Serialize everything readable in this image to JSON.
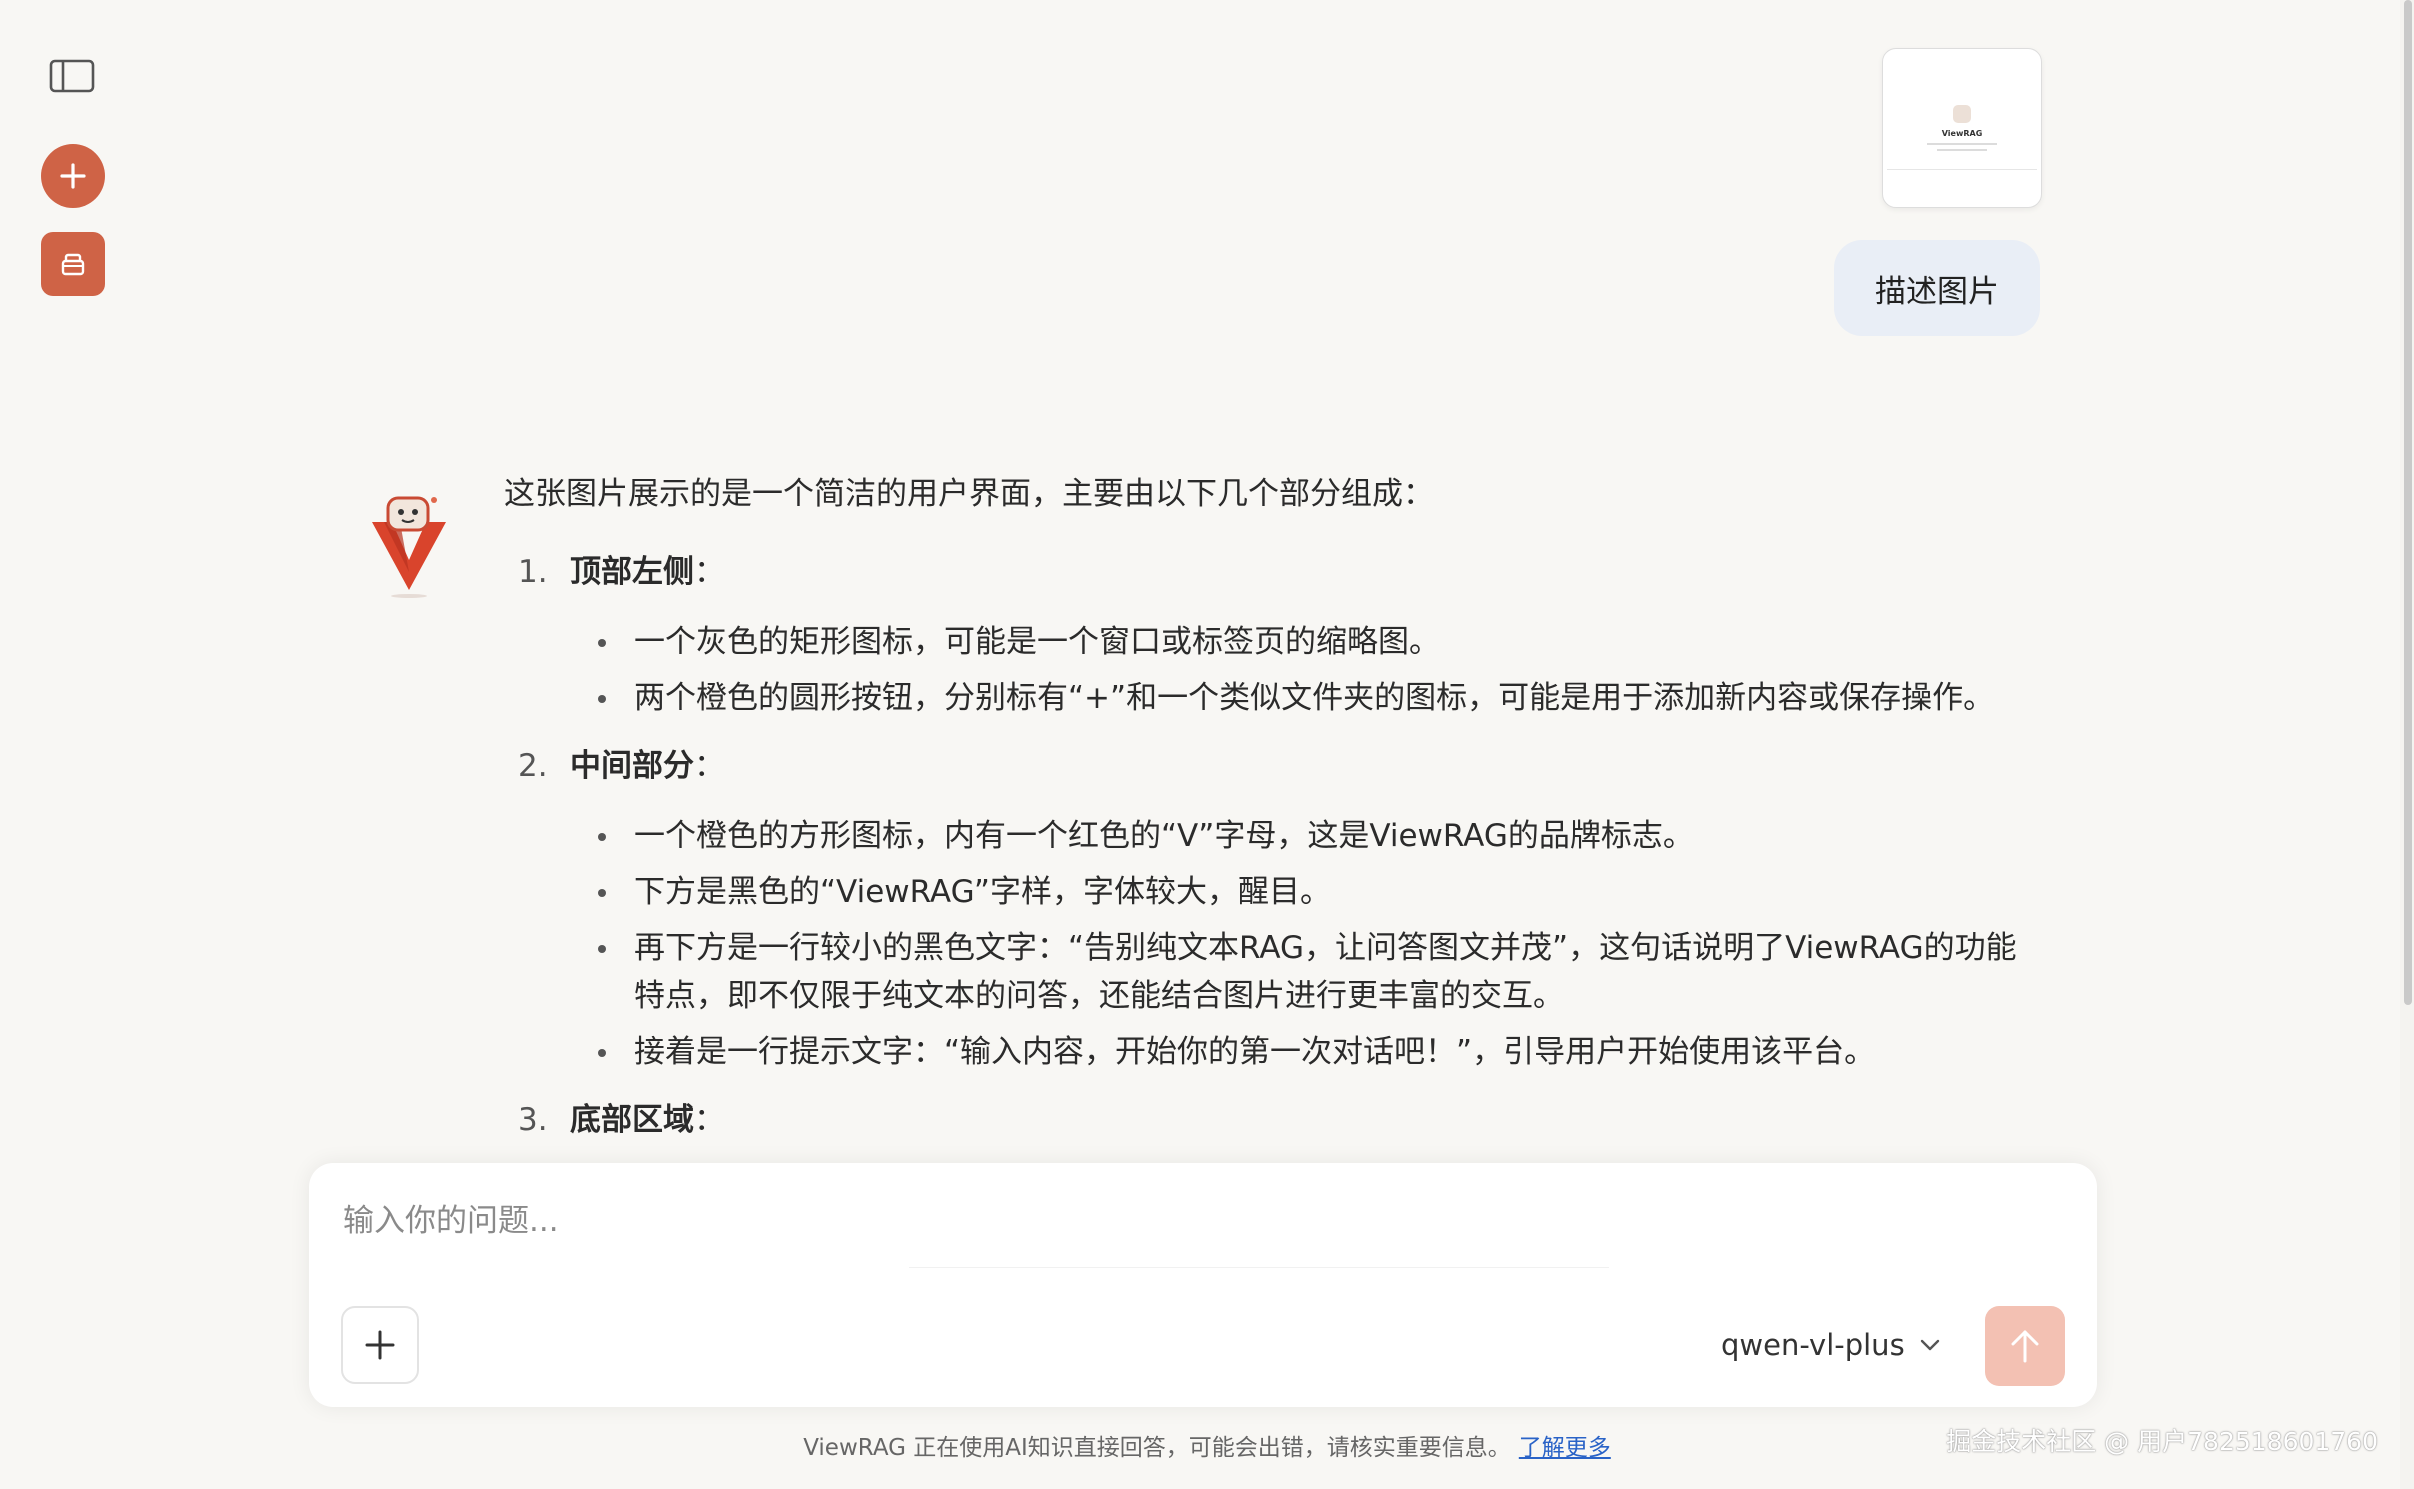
{
  "sidebar": {
    "toggle_icon": "sidebar-toggle-icon",
    "new_chat_icon": "plus-icon",
    "library_icon": "folder-icon",
    "accent_color": "#cf6346"
  },
  "user_message": {
    "attachment_title": "ViewRAG",
    "text": "描述图片"
  },
  "assistant_message": {
    "intro": "这张图片展示的是一个简洁的用户界面，主要由以下几个部分组成：",
    "sections": [
      {
        "number": "1.",
        "title": "顶部左侧",
        "colon": "：",
        "bullets": [
          "一个灰色的矩形图标，可能是一个窗口或标签页的缩略图。",
          "两个橙色的圆形按钮，分别标有“+”和一个类似文件夹的图标，可能是用于添加新内容或保存操作。"
        ]
      },
      {
        "number": "2.",
        "title": "中间部分",
        "colon": "：",
        "bullets": [
          "一个橙色的方形图标，内有一个红色的“V”字母，这是ViewRAG的品牌标志。",
          "下方是黑色的“ViewRAG”字样，字体较大，醒目。",
          "再下方是一行较小的黑色文字：“告别纯文本RAG，让问答图文并茂”，这句话说明了ViewRAG的功能特点，即不仅限于纯文本的问答，还能结合图片进行更丰富的交互。",
          "接着是一行提示文字：“输入内容，开始你的第一次对话吧！”，引导用户开始使用该平台。"
        ]
      },
      {
        "number": "3.",
        "title": "底部区域",
        "colon": "：",
        "bullets": []
      }
    ]
  },
  "composer": {
    "placeholder": "输入你的问题...",
    "value": "",
    "model": "qwen-vl-plus",
    "attach_icon": "plus-icon",
    "send_icon": "arrow-up-icon",
    "send_color": "#f3c1b3"
  },
  "footer": {
    "note": "ViewRAG 正在使用AI知识直接回答，可能会出错，请核实重要信息。",
    "link": "了解更多"
  },
  "watermark": "掘金技术社区 @ 用户782518601760"
}
